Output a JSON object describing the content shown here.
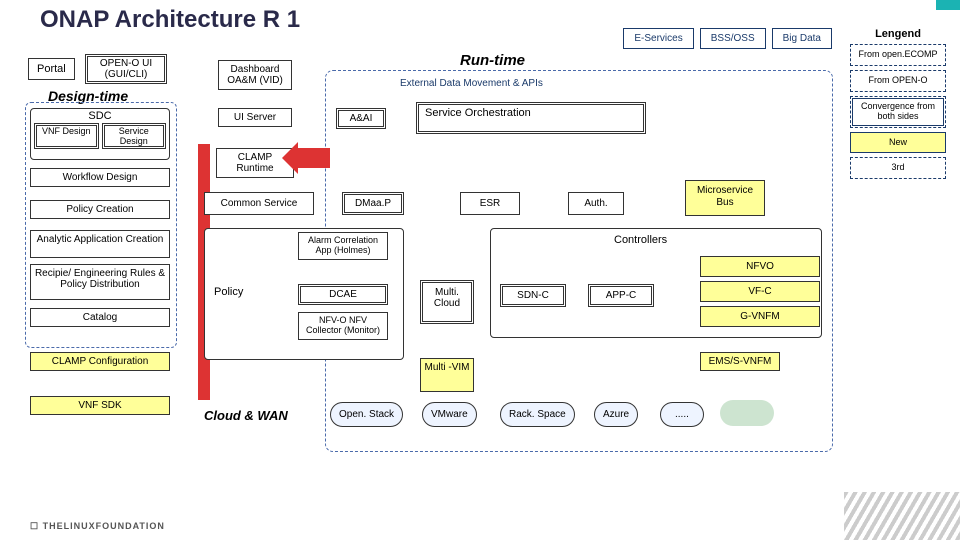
{
  "title": "ONAP Architecture R 1",
  "top": {
    "e": "E-Services",
    "b": "BSS/OSS",
    "d": "Big Data"
  },
  "legend": {
    "hd": "Lengend",
    "i": [
      "From open.ECOMP",
      "From OPEN-O",
      "Convergence from both sides",
      "New",
      "3rd"
    ]
  },
  "runtime": "Run-time",
  "apis": "External Data Movement & APIs",
  "portal": "Portal",
  "openoui": "OPEN-O UI (GUI/CLI)",
  "dtime": "Design-time",
  "dash": "Dashboard OA&M (VID)",
  "uisrv": "UI Server",
  "sdc": {
    "lbl": "SDC",
    "a": "VNF Design",
    "b": "Service Design"
  },
  "dt": {
    "wfd": "Workflow Design",
    "pc": "Policy Creation",
    "aac": "Analytic Application Creation",
    "rep": "Recipie/ Engineering Rules & Policy Distribution",
    "cat": "Catalog",
    "clampc": "CLAMP Configuration",
    "vnfsdk": "VNF SDK"
  },
  "aai": "A&AI",
  "so": "Service Orchestration",
  "clampr": "CLAMP Runtime",
  "cs": "Common Service",
  "dmaap": "DMaa.P",
  "esr": "ESR",
  "auth": "Auth.",
  "msbus": "Microservice Bus",
  "policy": "Policy",
  "alarm": "Alarm Correlation App (Holmes)",
  "dcae": "DCAE",
  "nfvo": "NFV-O NFV Collector (Monitor)",
  "mcloud": "Multi. Cloud",
  "ctrl": "Controllers",
  "sdnc": "SDN-C",
  "appc": "APP-C",
  "vert": {
    "n": "NFVO",
    "v": "VF-C",
    "g": "G-VNFM"
  },
  "mvim": "Multi -VIM",
  "ems": "EMS/S-VNFM",
  "cloudw": "Cloud & WAN",
  "clouds": {
    "c1": "Open. Stack",
    "c2": "VMware",
    "c3": "Rack. Space",
    "c4": "Azure",
    "c5": "....."
  },
  "lf": "THELINUXFOUNDATION"
}
